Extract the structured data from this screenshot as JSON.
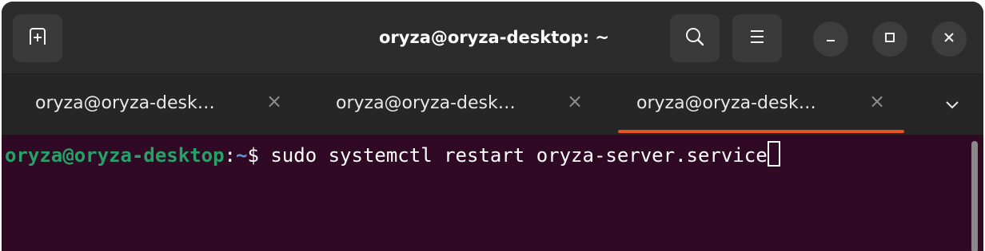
{
  "window": {
    "title": "oryza@oryza-desktop: ~"
  },
  "header": {
    "new_tab_icon": "new-tab-icon",
    "search_icon": "search-icon",
    "menu_icon": "hamburger-menu-icon",
    "minimize_icon": "minimize-icon",
    "maximize_icon": "maximize-icon",
    "close_icon": "close-icon"
  },
  "tabs": [
    {
      "label": "oryza@oryza-desk…",
      "close": "×",
      "active": false
    },
    {
      "label": "oryza@oryza-desk…",
      "close": "×",
      "active": false
    },
    {
      "label": "oryza@oryza-desk…",
      "close": "×",
      "active": true
    }
  ],
  "tab_menu_icon": "chevron-down-icon",
  "terminal": {
    "user_host": "oryza@oryza-desktop",
    "colon": ":",
    "path": "~",
    "prompt_symbol": "$ ",
    "command": "sudo systemctl restart oryza-server.service"
  },
  "colors": {
    "accent": "#e95420",
    "terminal_bg": "#300a24",
    "prompt_user": "#26a269"
  }
}
